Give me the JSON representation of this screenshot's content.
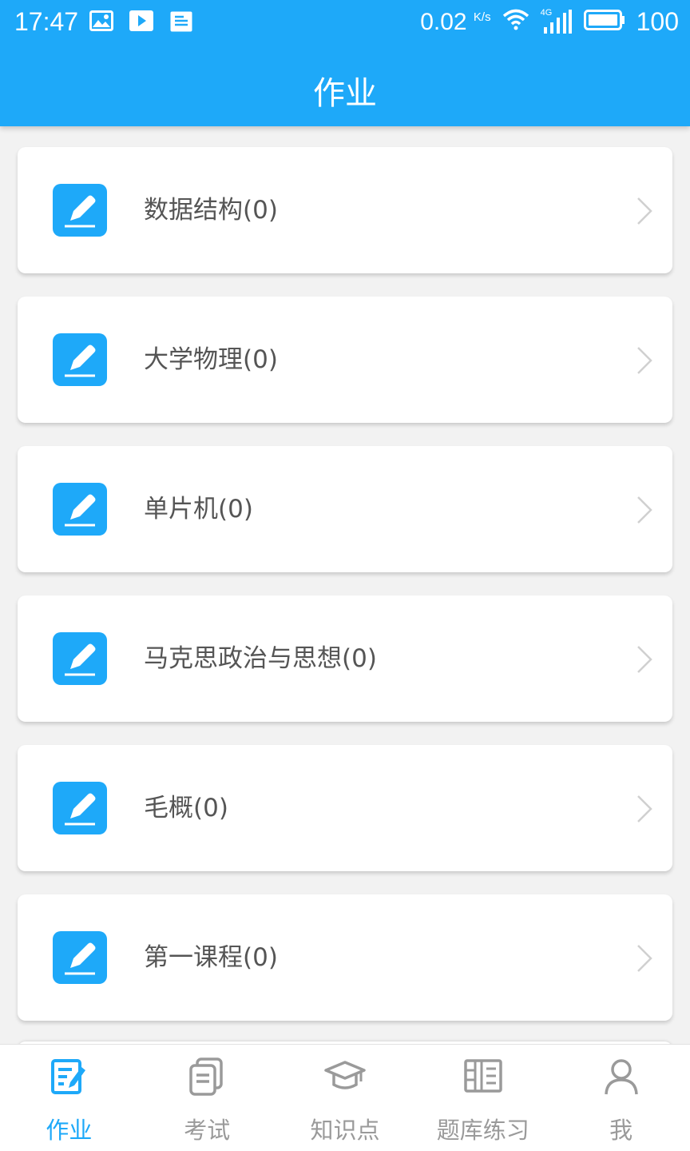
{
  "status_bar": {
    "time": "17:47",
    "net_speed": "0.02",
    "net_unit": "K/s",
    "signal_label": "4G",
    "battery": "100",
    "left_icons": [
      "image-icon",
      "play-icon",
      "document-icon"
    ]
  },
  "header": {
    "title": "作业"
  },
  "courses": [
    {
      "label": "数据结构(0)"
    },
    {
      "label": "大学物理(0)"
    },
    {
      "label": "单片机(0)"
    },
    {
      "label": "马克思政治与思想(0)"
    },
    {
      "label": "毛概(0)"
    },
    {
      "label": "第一课程(0)"
    }
  ],
  "tabbar": {
    "items": [
      {
        "label": "作业",
        "icon": "homework-icon",
        "active": true
      },
      {
        "label": "考试",
        "icon": "exam-icon",
        "active": false
      },
      {
        "label": "知识点",
        "icon": "graduation-cap-icon",
        "active": false
      },
      {
        "label": "题库练习",
        "icon": "question-bank-icon",
        "active": false
      },
      {
        "label": "我",
        "icon": "person-icon",
        "active": false
      }
    ]
  },
  "colors": {
    "primary": "#1ea9f9",
    "text": "#555555",
    "inactive": "#9a9a9a",
    "background": "#f2f2f2"
  }
}
